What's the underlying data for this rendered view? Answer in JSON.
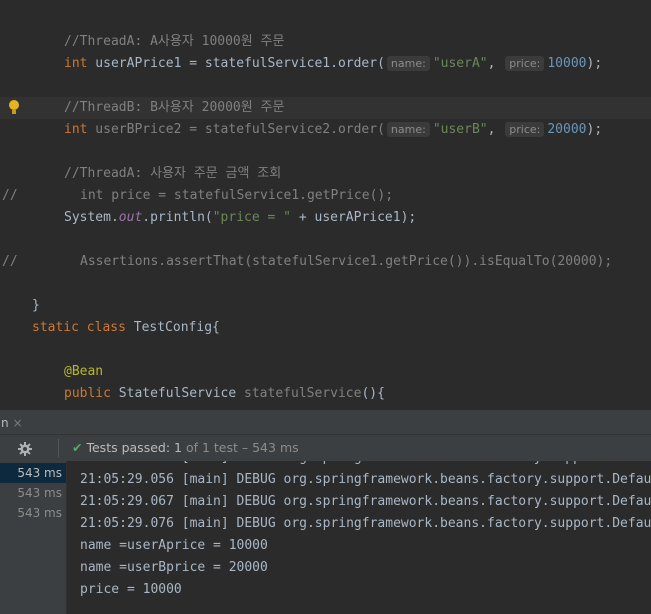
{
  "editor": {
    "line1_comment": "//ThreadA: A사용자 10000원 주문",
    "line2": {
      "kw": "int",
      "var": " userAPrice1 = statefulService1.order(",
      "hint_name": "name:",
      "str": "\"userA\"",
      "comma": ",",
      "hint_price": "price:",
      "num": "10000",
      "end": ");"
    },
    "line4_comment": "//ThreadB: B사용자 20000원 주문",
    "line5": {
      "kw": "int",
      "var": " userBPrice2 = statefulService2.order(",
      "hint_name": "name:",
      "str": "\"userB\"",
      "comma": ",",
      "hint_price": "price:",
      "num": "20000",
      "end": ");"
    },
    "line7_comment": "//ThreadA: 사용자 주문 금액 조회",
    "line8_slash": "//",
    "line8_code": "int price = statefulService1.getPrice();",
    "line9": {
      "pre": "System.",
      "out": "out",
      "mid": ".println(",
      "str": "\"price = \"",
      "end": " + userAPrice1);"
    },
    "line11_slash": "//",
    "line11_code": "Assertions.assertThat(statefulService1.getPrice()).isEqualTo(20000);",
    "line12": "}",
    "line14": {
      "kw": "static class",
      "name": " TestConfig{"
    },
    "line16": "@Bean",
    "line17": {
      "kw": "public",
      "type": " StatefulService ",
      "method": "statefulService",
      "end": "(){"
    }
  },
  "run_tab": {
    "label": "n",
    "close": "×"
  },
  "toolbar": {
    "tests_passed": "Tests passed:",
    "count": " 1",
    "of_total": " of 1 test – 543 ms"
  },
  "left_panel": {
    "items": [
      "543 ms",
      "543 ms",
      "543 ms"
    ]
  },
  "console": {
    "lines": [
      "21:05:29.056 [main] DEBUG org.springframework.beans.factory.support.Defau",
      "21:05:29.067 [main] DEBUG org.springframework.beans.factory.support.Defau",
      "21:05:29.076 [main] DEBUG org.springframework.beans.factory.support.Defau",
      "name =userAprice = 10000",
      "name =userBprice = 20000",
      "price = 10000"
    ]
  },
  "colors": {
    "background": "#2b2b2b",
    "keyword": "#cc7832",
    "string": "#6a8759",
    "number": "#6897bb",
    "comment": "#808080",
    "pass_check": "#59a869"
  },
  "icons": [
    "lightbulb-icon",
    "gear-icon",
    "check-icon",
    "close-icon"
  ]
}
